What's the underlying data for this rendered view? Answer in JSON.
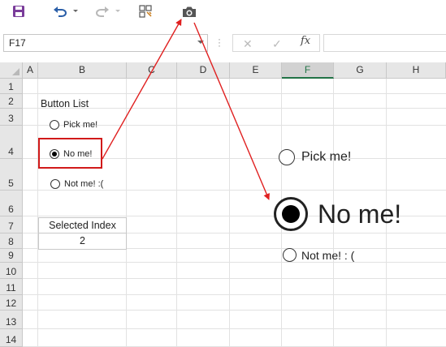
{
  "toolbar": {
    "save_icon": "save-icon",
    "undo_icon": "undo-icon",
    "redo_icon": "redo-icon",
    "format_icon": "format-painter-icon",
    "camera_icon": "camera-icon"
  },
  "formula_bar": {
    "name_box": "F17",
    "cancel": "✕",
    "enter": "✓",
    "fx": "fx",
    "formula_value": ""
  },
  "columns": [
    "A",
    "B",
    "C",
    "D",
    "E",
    "F",
    "G",
    "H"
  ],
  "selected_column": "F",
  "rows": [
    "1",
    "2",
    "3",
    "4",
    "5",
    "6",
    "7",
    "8",
    "9",
    "10",
    "11",
    "12",
    "13",
    "14"
  ],
  "sheet": {
    "button_list_label": "Button List",
    "radios": [
      {
        "label": "Pick me!",
        "checked": false
      },
      {
        "label": "No me!",
        "checked": true
      },
      {
        "label": "Not me! :(",
        "checked": false
      }
    ],
    "selected_index_header": "Selected Index",
    "selected_index_value": "2"
  },
  "camera_picture": {
    "radios": [
      {
        "label": "Pick me!",
        "checked": false
      },
      {
        "label": "No me!",
        "checked": true
      },
      {
        "label": "Not me! : (",
        "checked": false
      }
    ]
  },
  "colors": {
    "highlight_box": "#d11a1a",
    "arrow": "#e02020",
    "accent": "#217346",
    "save_icon": "#7a3c9a",
    "undo_icon": "#2b5fa8"
  }
}
